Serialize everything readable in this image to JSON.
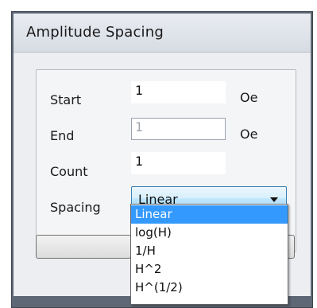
{
  "dialog": {
    "title": "Amplitude Spacing"
  },
  "form": {
    "start": {
      "label": "Start",
      "value": "1",
      "unit": "Oe"
    },
    "end": {
      "label": "End",
      "value": "1",
      "unit": "Oe"
    },
    "count": {
      "label": "Count",
      "value": "1"
    },
    "spacing": {
      "label": "Spacing",
      "selected": "Linear",
      "options": [
        "Linear",
        "log(H)",
        "1/H",
        "H^2",
        "H^(1/2)"
      ]
    }
  },
  "colors": {
    "selection_highlight": "#3399ff",
    "combo_border": "#3c7fb1",
    "frame": "#5d6775"
  }
}
